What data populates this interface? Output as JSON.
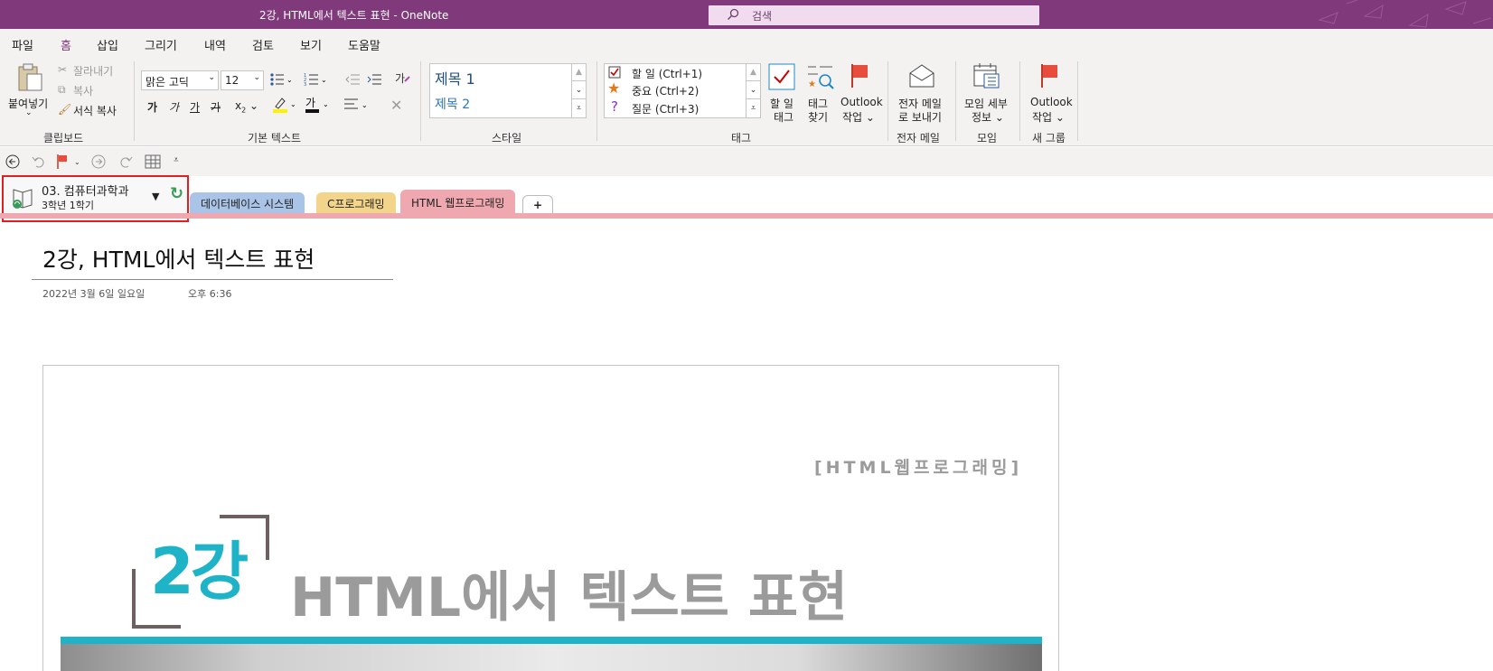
{
  "window": {
    "title": "2강, HTML에서 텍스트 표현  -  OneNote",
    "search_placeholder": "검색"
  },
  "menu": [
    "파일",
    "홈",
    "삽입",
    "그리기",
    "내역",
    "검토",
    "보기",
    "도움말"
  ],
  "ribbon": {
    "clipboard": {
      "paste": "붙여넣기",
      "cut": "잘라내기",
      "copy": "복사",
      "format_painter": "서식 복사",
      "label": "클립보드"
    },
    "basic_text": {
      "font": "맑은 고딕",
      "size": "12",
      "label": "기본 텍스트",
      "bold": "가",
      "italic": "가",
      "underline": "가",
      "strike": "가",
      "subscript": "x",
      "sub_mark": "2"
    },
    "styles": {
      "heading1": "제목 1",
      "heading2": "제목 2",
      "label": "스타일"
    },
    "tags": {
      "todo": "할 일 (Ctrl+1)",
      "important": "중요 (Ctrl+2)",
      "question": "질문 (Ctrl+3)",
      "label": "태그",
      "todo_tag": [
        "할 일",
        "태그"
      ],
      "find_tags": [
        "태그",
        "찾기"
      ],
      "outlook_tasks": [
        "Outlook",
        "작업"
      ]
    },
    "email": {
      "send": [
        "전자 메일",
        "로 보내기"
      ],
      "label": "전자 메일"
    },
    "meetings": {
      "details": [
        "모임 세부",
        "정보"
      ],
      "label": "모임"
    },
    "new_group": {
      "outlook_tasks": [
        "Outlook",
        "작업"
      ],
      "label": "새 그룹"
    }
  },
  "notebook": {
    "name": "03. 컴퓨터과학과",
    "section_group": "3학년 1학기"
  },
  "sections": [
    {
      "label": "데이터베이스 시스템",
      "color": "#a9c4e6"
    },
    {
      "label": "C프로그래밍",
      "color": "#f2d48a"
    },
    {
      "label": "HTML 웹프로그래밍",
      "color": "#f0a8b0"
    },
    {
      "label": "+",
      "color": "#ffffff"
    }
  ],
  "page": {
    "title": "2강, HTML에서 텍스트 표현",
    "date": "2022년 3월 6일 일요일",
    "time": "오후 6:36",
    "slide": {
      "header": "[HTML웹프로그래밍]",
      "lecture": "2강",
      "title": "HTML에서 텍스트 표현",
      "accent": "#1fb3c8",
      "gray": "#9b9b9b"
    }
  }
}
